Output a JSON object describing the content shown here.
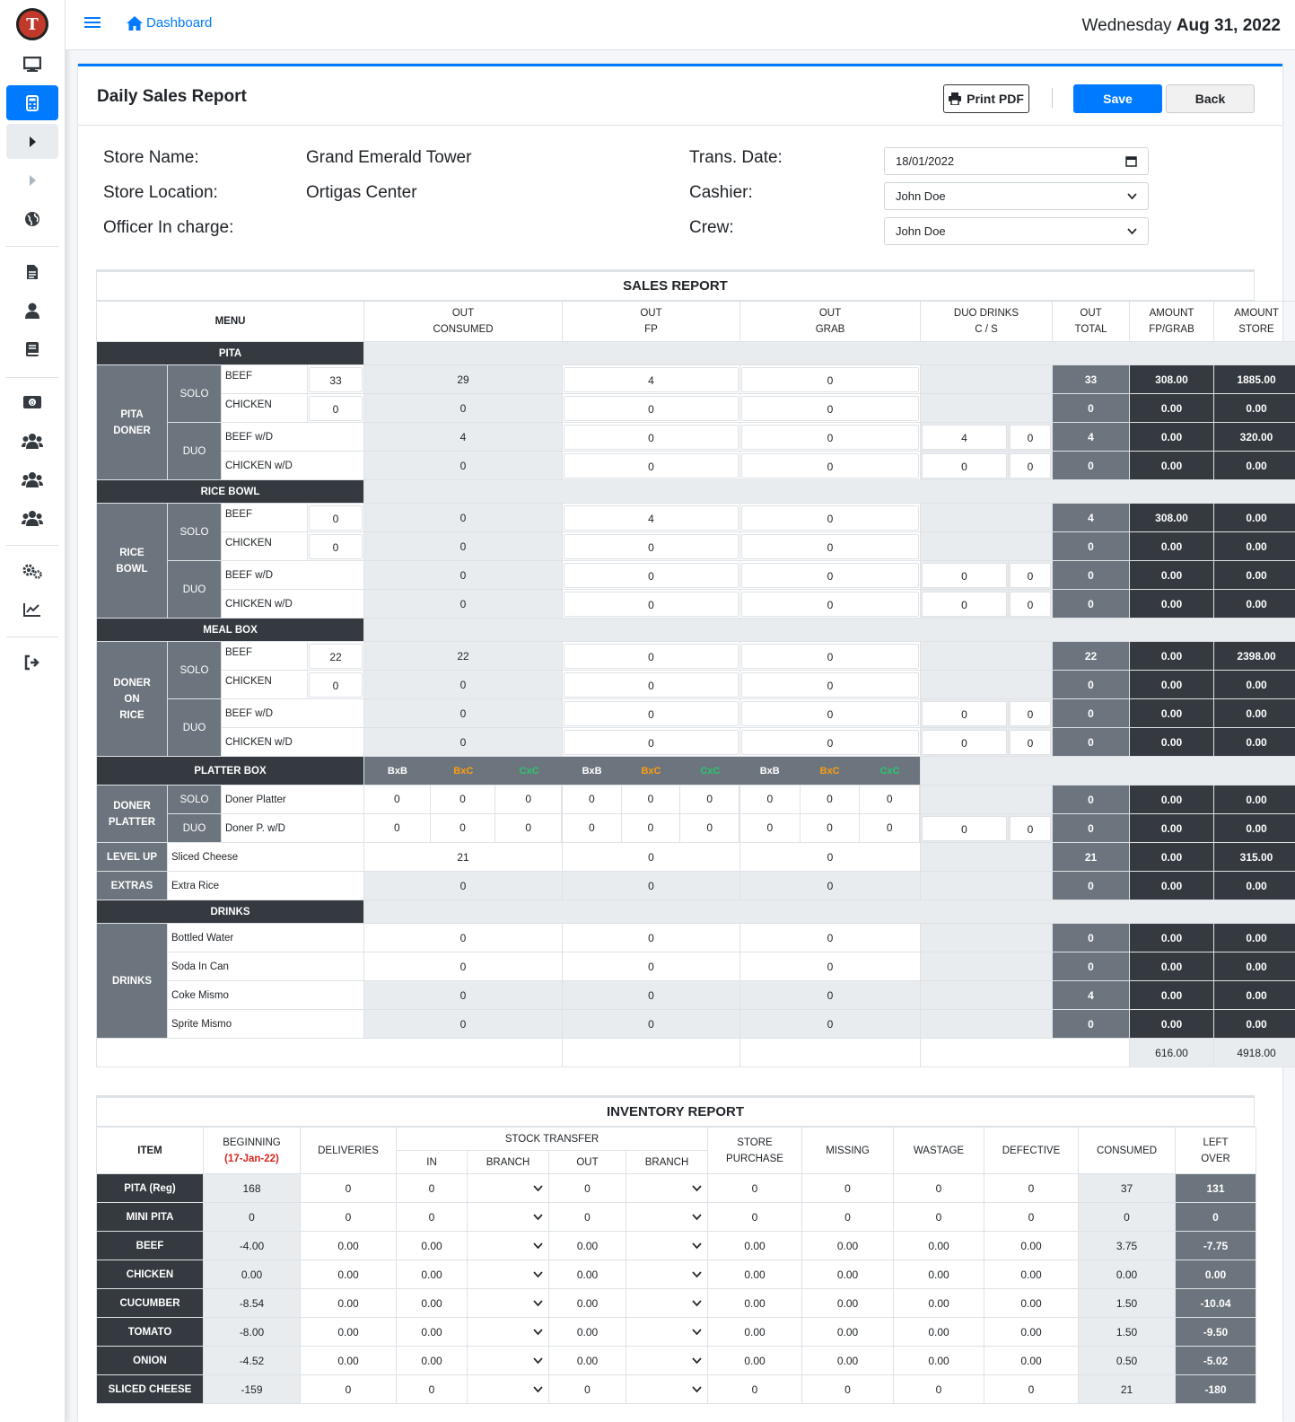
{
  "sidebar": {
    "logo_letter": "T",
    "items": [
      "desktop-icon",
      "calculator-icon",
      "caret-right-icon",
      "caret-right-icon",
      "globe-icon",
      "file-icon",
      "user-icon",
      "book-icon",
      "money-icon",
      "users-icon",
      "users-icon",
      "users-icon",
      "cogs-icon",
      "chart-line-icon",
      "sign-out-icon"
    ]
  },
  "topbar": {
    "home_label": "Dashboard",
    "weekday": "Wednesday",
    "date": "Aug 31, 2022"
  },
  "header": {
    "title": "Daily Sales Report",
    "print_label": "Print PDF",
    "save_label": "Save",
    "back_label": "Back"
  },
  "info": {
    "store_name_label": "Store Name:",
    "store_name": "Grand Emerald Tower",
    "store_location_label": "Store Location:",
    "store_location": "Ortigas Center",
    "officer_label": "Officer In charge:",
    "trans_date_label": "Trans. Date:",
    "trans_date": "18/01/2022",
    "cashier_label": "Cashier:",
    "cashier": "John Doe",
    "crew_label": "Crew:",
    "crew": "John Doe"
  },
  "sales": {
    "title": "SALES REPORT",
    "headers": {
      "menu": "MENU",
      "out_consumed": [
        "OUT",
        "CONSUMED"
      ],
      "out_fp": [
        "OUT",
        "FP"
      ],
      "out_grab": [
        "OUT",
        "GRAB"
      ],
      "duo": [
        "DUO DRINKS",
        "C / S"
      ],
      "out_total": [
        "OUT",
        "TOTAL"
      ],
      "amt_fp": [
        "AMOUNT",
        "FP/GRAB"
      ],
      "amt_store": [
        "AMOUNT",
        "STORE"
      ]
    },
    "sections": [
      {
        "cat": "PITA",
        "group": [
          "PITA",
          "DONER"
        ],
        "rows": [
          {
            "sub": "SOLO",
            "item": "BEEF",
            "qty": "33",
            "consumed": "29",
            "fp": "4",
            "grab": "0",
            "total": "33",
            "amt_fp": "308.00",
            "amt_store": "1885.00"
          },
          {
            "item": "CHICKEN",
            "qty": "0",
            "consumed": "0",
            "fp": "0",
            "grab": "0",
            "total": "0",
            "amt_fp": "0.00",
            "amt_store": "0.00"
          },
          {
            "sub": "DUO",
            "item": "BEEF w/D",
            "consumed": "4",
            "fp": "0",
            "grab": "0",
            "c": "4",
            "s": "0",
            "total": "4",
            "amt_fp": "0.00",
            "amt_store": "320.00"
          },
          {
            "item": "CHICKEN w/D",
            "consumed": "0",
            "fp": "0",
            "grab": "0",
            "c": "0",
            "s": "0",
            "total": "0",
            "amt_fp": "0.00",
            "amt_store": "0.00"
          }
        ]
      },
      {
        "cat": "RICE BOWL",
        "group": [
          "RICE",
          "BOWL"
        ],
        "rows": [
          {
            "sub": "SOLO",
            "item": "BEEF",
            "qty": "0",
            "consumed": "0",
            "fp": "4",
            "grab": "0",
            "total": "4",
            "amt_fp": "308.00",
            "amt_store": "0.00"
          },
          {
            "item": "CHICKEN",
            "qty": "0",
            "consumed": "0",
            "fp": "0",
            "grab": "0",
            "total": "0",
            "amt_fp": "0.00",
            "amt_store": "0.00"
          },
          {
            "sub": "DUO",
            "item": "BEEF w/D",
            "consumed": "0",
            "fp": "0",
            "grab": "0",
            "c": "0",
            "s": "0",
            "total": "0",
            "amt_fp": "0.00",
            "amt_store": "0.00"
          },
          {
            "item": "CHICKEN w/D",
            "consumed": "0",
            "fp": "0",
            "grab": "0",
            "c": "0",
            "s": "0",
            "total": "0",
            "amt_fp": "0.00",
            "amt_store": "0.00"
          }
        ]
      },
      {
        "cat": "MEAL BOX",
        "group": [
          "DONER",
          "ON",
          "RICE"
        ],
        "rows": [
          {
            "sub": "SOLO",
            "item": "BEEF",
            "qty": "22",
            "consumed": "22",
            "fp": "0",
            "grab": "0",
            "total": "22",
            "amt_fp": "0.00",
            "amt_store": "2398.00"
          },
          {
            "item": "CHICKEN",
            "qty": "0",
            "consumed": "0",
            "fp": "0",
            "grab": "0",
            "total": "0",
            "amt_fp": "0.00",
            "amt_store": "0.00"
          },
          {
            "sub": "DUO",
            "item": "BEEF w/D",
            "consumed": "0",
            "fp": "0",
            "grab": "0",
            "c": "0",
            "s": "0",
            "total": "0",
            "amt_fp": "0.00",
            "amt_store": "0.00"
          },
          {
            "item": "CHICKEN w/D",
            "consumed": "0",
            "fp": "0",
            "grab": "0",
            "c": "0",
            "s": "0",
            "total": "0",
            "amt_fp": "0.00",
            "amt_store": "0.00"
          }
        ]
      }
    ],
    "platter": {
      "cat": "PLATTER BOX",
      "codes": [
        "BxB",
        "BxC",
        "CxC"
      ],
      "group": [
        "DONER",
        "PLATTER"
      ],
      "rows": [
        {
          "sub": "SOLO",
          "item": "Doner Platter",
          "vals": [
            "0",
            "0",
            "0",
            "0",
            "0",
            "0",
            "0",
            "0",
            "0"
          ],
          "total": "0",
          "amt_fp": "0.00",
          "amt_store": "0.00"
        },
        {
          "sub": "DUO",
          "item": "Doner P. w/D",
          "vals": [
            "0",
            "0",
            "0",
            "0",
            "0",
            "0",
            "0",
            "0",
            "0"
          ],
          "c": "0",
          "s": "0",
          "total": "0",
          "amt_fp": "0.00",
          "amt_store": "0.00"
        }
      ]
    },
    "levelup": {
      "group": "LEVEL UP",
      "item": "Sliced Cheese",
      "consumed": "21",
      "fp": "0",
      "grab": "0",
      "total": "21",
      "amt_fp": "0.00",
      "amt_store": "315.00"
    },
    "extras": {
      "group": "EXTRAS",
      "item": "Extra Rice",
      "consumed": "0",
      "fp": "0",
      "grab": "0",
      "total": "0",
      "amt_fp": "0.00",
      "amt_store": "0.00"
    },
    "drinks": {
      "cat": "DRINKS",
      "group": "DRINKS",
      "rows": [
        {
          "item": "Bottled Water",
          "consumed": "0",
          "fp": "0",
          "grab": "0",
          "total": "0",
          "amt_fp": "0.00",
          "amt_store": "0.00"
        },
        {
          "item": "Soda In Can",
          "consumed": "0",
          "fp": "0",
          "grab": "0",
          "total": "0",
          "amt_fp": "0.00",
          "amt_store": "0.00"
        },
        {
          "item": "Coke Mismo",
          "consumed": "0",
          "fp": "0",
          "grab": "0",
          "total": "4",
          "amt_fp": "0.00",
          "amt_store": "0.00"
        },
        {
          "item": "Sprite Mismo",
          "consumed": "0",
          "fp": "0",
          "grab": "0",
          "total": "0",
          "amt_fp": "0.00",
          "amt_store": "0.00"
        }
      ]
    },
    "totals": {
      "amt_fp": "616.00",
      "amt_store": "4918.00"
    }
  },
  "inventory": {
    "title": "INVENTORY REPORT",
    "headers": {
      "item": "ITEM",
      "beginning": "BEGINNING",
      "beginning_date": "(17-Jan-22)",
      "deliveries": "DELIVERIES",
      "stock_transfer": "STOCK TRANSFER",
      "in": "IN",
      "branch": "BRANCH",
      "out": "OUT",
      "store_purchase": [
        "STORE",
        "PURCHASE"
      ],
      "missing": "MISSING",
      "wastage": "WASTAGE",
      "defective": "DEFECTIVE",
      "consumed": "CONSUMED",
      "leftover": [
        "LEFT",
        "OVER"
      ]
    },
    "rows": [
      {
        "item": "PITA (Reg)",
        "beginning": "168",
        "deliveries": "0",
        "in": "0",
        "out": "0",
        "purchase": "0",
        "missing": "0",
        "wastage": "0",
        "defective": "0",
        "consumed": "37",
        "leftover": "131"
      },
      {
        "item": "MINI PITA",
        "beginning": "0",
        "deliveries": "0",
        "in": "0",
        "out": "0",
        "purchase": "0",
        "missing": "0",
        "wastage": "0",
        "defective": "0",
        "consumed": "0",
        "leftover": "0"
      },
      {
        "item": "BEEF",
        "beginning": "-4.00",
        "deliveries": "0.00",
        "in": "0.00",
        "out": "0.00",
        "purchase": "0.00",
        "missing": "0.00",
        "wastage": "0.00",
        "defective": "0.00",
        "consumed": "3.75",
        "leftover": "-7.75"
      },
      {
        "item": "CHICKEN",
        "beginning": "0.00",
        "deliveries": "0.00",
        "in": "0.00",
        "out": "0.00",
        "purchase": "0.00",
        "missing": "0.00",
        "wastage": "0.00",
        "defective": "0.00",
        "consumed": "0.00",
        "leftover": "0.00"
      },
      {
        "item": "CUCUMBER",
        "beginning": "-8.54",
        "deliveries": "0.00",
        "in": "0.00",
        "out": "0.00",
        "purchase": "0.00",
        "missing": "0.00",
        "wastage": "0.00",
        "defective": "0.00",
        "consumed": "1.50",
        "leftover": "-10.04"
      },
      {
        "item": "TOMATO",
        "beginning": "-8.00",
        "deliveries": "0.00",
        "in": "0.00",
        "out": "0.00",
        "purchase": "0.00",
        "missing": "0.00",
        "wastage": "0.00",
        "defective": "0.00",
        "consumed": "1.50",
        "leftover": "-9.50"
      },
      {
        "item": "ONION",
        "beginning": "-4.52",
        "deliveries": "0.00",
        "in": "0.00",
        "out": "0.00",
        "purchase": "0.00",
        "missing": "0.00",
        "wastage": "0.00",
        "defective": "0.00",
        "consumed": "0.50",
        "leftover": "-5.02"
      },
      {
        "item": "SLICED CHEESE",
        "beginning": "-159",
        "deliveries": "0",
        "in": "0",
        "out": "0",
        "purchase": "0",
        "missing": "0",
        "wastage": "0",
        "defective": "0",
        "consumed": "21",
        "leftover": "-180"
      }
    ]
  }
}
